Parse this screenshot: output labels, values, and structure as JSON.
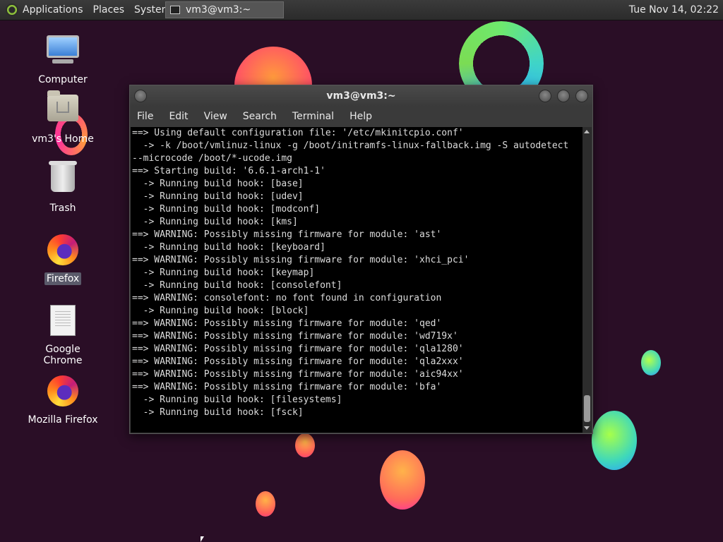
{
  "panel": {
    "menus": [
      "Applications",
      "Places",
      "System"
    ],
    "task_label": "vm3@vm3:~",
    "clock": "Tue Nov 14, 02:22"
  },
  "desktop": {
    "icons": [
      {
        "label": "Computer",
        "icon": "computer-icon"
      },
      {
        "label": "vm3's Home",
        "icon": "home-folder-icon"
      },
      {
        "label": "Trash",
        "icon": "trash-icon"
      },
      {
        "label": "Firefox",
        "icon": "firefox-icon",
        "selected": true
      },
      {
        "label": "Google Chrome",
        "icon": "document-icon"
      },
      {
        "label": "Mozilla Firefox",
        "icon": "firefox-icon"
      }
    ]
  },
  "terminal": {
    "title": "vm3@vm3:~",
    "menu": [
      "File",
      "Edit",
      "View",
      "Search",
      "Terminal",
      "Help"
    ],
    "lines": [
      "==> Using default configuration file: '/etc/mkinitcpio.conf'",
      "  -> -k /boot/vmlinuz-linux -g /boot/initramfs-linux-fallback.img -S autodetect",
      "--microcode /boot/*-ucode.img",
      "==> Starting build: '6.6.1-arch1-1'",
      "  -> Running build hook: [base]",
      "  -> Running build hook: [udev]",
      "  -> Running build hook: [modconf]",
      "  -> Running build hook: [kms]",
      "==> WARNING: Possibly missing firmware for module: 'ast'",
      "  -> Running build hook: [keyboard]",
      "==> WARNING: Possibly missing firmware for module: 'xhci_pci'",
      "  -> Running build hook: [keymap]",
      "  -> Running build hook: [consolefont]",
      "==> WARNING: consolefont: no font found in configuration",
      "  -> Running build hook: [block]",
      "==> WARNING: Possibly missing firmware for module: 'qed'",
      "==> WARNING: Possibly missing firmware for module: 'wd719x'",
      "==> WARNING: Possibly missing firmware for module: 'qla1280'",
      "==> WARNING: Possibly missing firmware for module: 'qla2xxx'",
      "==> WARNING: Possibly missing firmware for module: 'aic94xx'",
      "==> WARNING: Possibly missing firmware for module: 'bfa'",
      "  -> Running build hook: [filesystems]",
      "  -> Running build hook: [fsck]"
    ]
  },
  "colors": {
    "desktop_bg": "#2a0e26",
    "terminal_bg": "#000000",
    "terminal_fg": "#dcdcdc"
  }
}
